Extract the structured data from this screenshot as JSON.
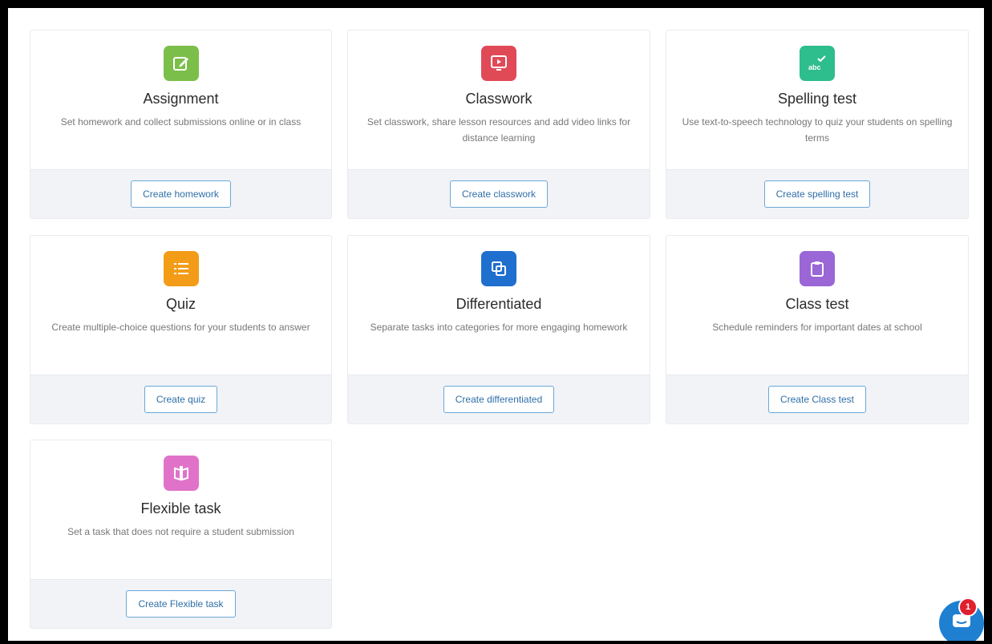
{
  "colors": {
    "assignment": "#7cbe4a",
    "classwork": "#e04a57",
    "spelling": "#2ebd8c",
    "quiz": "#f39c18",
    "differentiated": "#1f6fcf",
    "class_test": "#9b66d6",
    "flexible": "#e073c9",
    "button_border": "#6aa8d8",
    "button_text": "#2f6fa8",
    "footer_bg": "#f1f3f7",
    "chat": "#1f7fd1",
    "badge": "#e0202d"
  },
  "cards": [
    {
      "icon": "edit-square-icon",
      "title": "Assignment",
      "description": "Set homework and collect submissions online or in class",
      "button": "Create homework"
    },
    {
      "icon": "video-play-icon",
      "title": "Classwork",
      "description": "Set classwork, share lesson resources and add video links for distance learning",
      "button": "Create classwork"
    },
    {
      "icon": "abc-check-icon",
      "title": "Spelling test",
      "description": "Use text-to-speech technology to quiz your students on spelling terms",
      "button": "Create spelling test"
    },
    {
      "icon": "list-icon",
      "title": "Quiz",
      "description": "Create multiple-choice questions for your students to answer",
      "button": "Create quiz"
    },
    {
      "icon": "overlapping-squares-icon",
      "title": "Differentiated",
      "description": "Separate tasks into categories for more engaging homework",
      "button": "Create differentiated"
    },
    {
      "icon": "clipboard-icon",
      "title": "Class test",
      "description": "Schedule reminders for important dates at school",
      "button": "Create Class test"
    },
    {
      "icon": "open-book-icon",
      "title": "Flexible task",
      "description": "Set a task that does not require a student submission",
      "button": "Create Flexible task"
    }
  ],
  "chat": {
    "icon": "chat-bubble-icon",
    "badge_count": "1"
  }
}
